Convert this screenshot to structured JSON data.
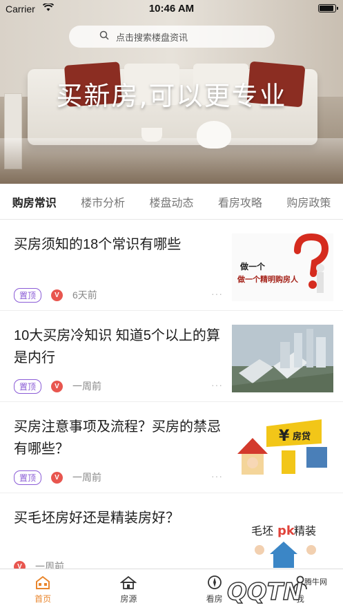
{
  "status": {
    "carrier": "Carrier",
    "time": "10:46 AM"
  },
  "search": {
    "placeholder": "点击搜索楼盘资讯"
  },
  "hero": {
    "slogan": "买新房,可以更专业"
  },
  "tabs": [
    {
      "label": "购房常识",
      "active": true
    },
    {
      "label": "楼市分析"
    },
    {
      "label": "楼盘动态"
    },
    {
      "label": "看房攻略"
    },
    {
      "label": "购房政策"
    }
  ],
  "articles": [
    {
      "title": "买房须知的18个常识有哪些",
      "badge": "置顶",
      "time": "6天前",
      "more": "···",
      "thumb_text": "做一个精明购房人"
    },
    {
      "title": "10大买房冷知识 知道5个以上的算是内行",
      "badge": "置顶",
      "time": "一周前",
      "more": "···"
    },
    {
      "title": "买房注意事项及流程？买房的禁忌有哪些？",
      "badge": "置顶",
      "time": "一周前",
      "more": "···",
      "thumb_text": "房贷"
    },
    {
      "title": "买毛坯房好还是精装房好？",
      "time": "一周前",
      "thumb_text_left": "毛坯",
      "thumb_text_mid": "pk",
      "thumb_text_right": "精装"
    }
  ],
  "tabbar": [
    {
      "label": "首页",
      "icon": "home-icon",
      "active": true
    },
    {
      "label": "房源",
      "icon": "house-icon"
    },
    {
      "label": "看房",
      "icon": "compass-icon"
    },
    {
      "label": "我",
      "icon": "user-icon"
    }
  ],
  "watermark": {
    "text": "QQTN",
    "sub": "腾牛网"
  },
  "colors": {
    "accent": "#e9862d",
    "badge": "#8a5bd6",
    "v_icon": "#e8564f"
  }
}
